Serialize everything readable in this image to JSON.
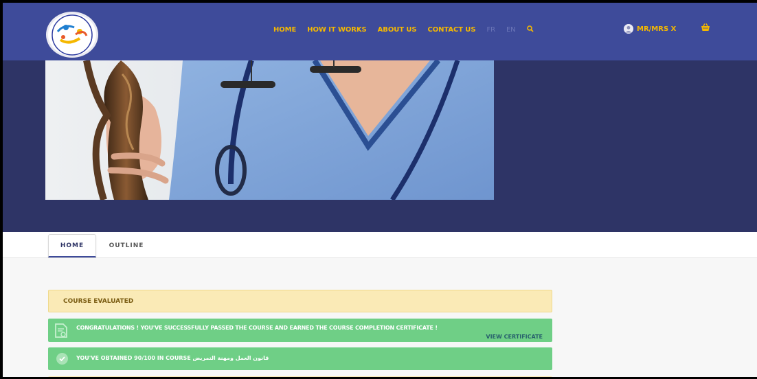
{
  "nav": {
    "items": [
      "HOME",
      "HOW IT WORKS",
      "ABOUT US",
      "CONTACT US"
    ],
    "lang_fr": "FR",
    "lang_en": "EN",
    "search_icon": "search-icon"
  },
  "user": {
    "label": "MR/MRS X",
    "avatar_icon": "user-avatar-icon"
  },
  "cart": {
    "icon": "basket-icon"
  },
  "tabs": [
    "HOME",
    "OUTLINE"
  ],
  "course": {
    "status": "COURSE EVALUATED",
    "certificate_message": "CONGRATULATIONS ! YOU'VE SUCCESSFULLY PASSED THE COURSE AND EARNED THE COURSE COMPLETION CERTIFICATE !",
    "certificate_link": "VIEW CERTIFICATE",
    "score_prefix": "YOU'VE OBTAINED 90/100 IN COURSE",
    "score_course_name": "قانون العمل ومهنة التمريض"
  },
  "colors": {
    "header": "#3e4b9a",
    "hero": "#2e3466",
    "accent": "#f5b800",
    "success": "#6fcf86",
    "notice": "#faeab6"
  }
}
